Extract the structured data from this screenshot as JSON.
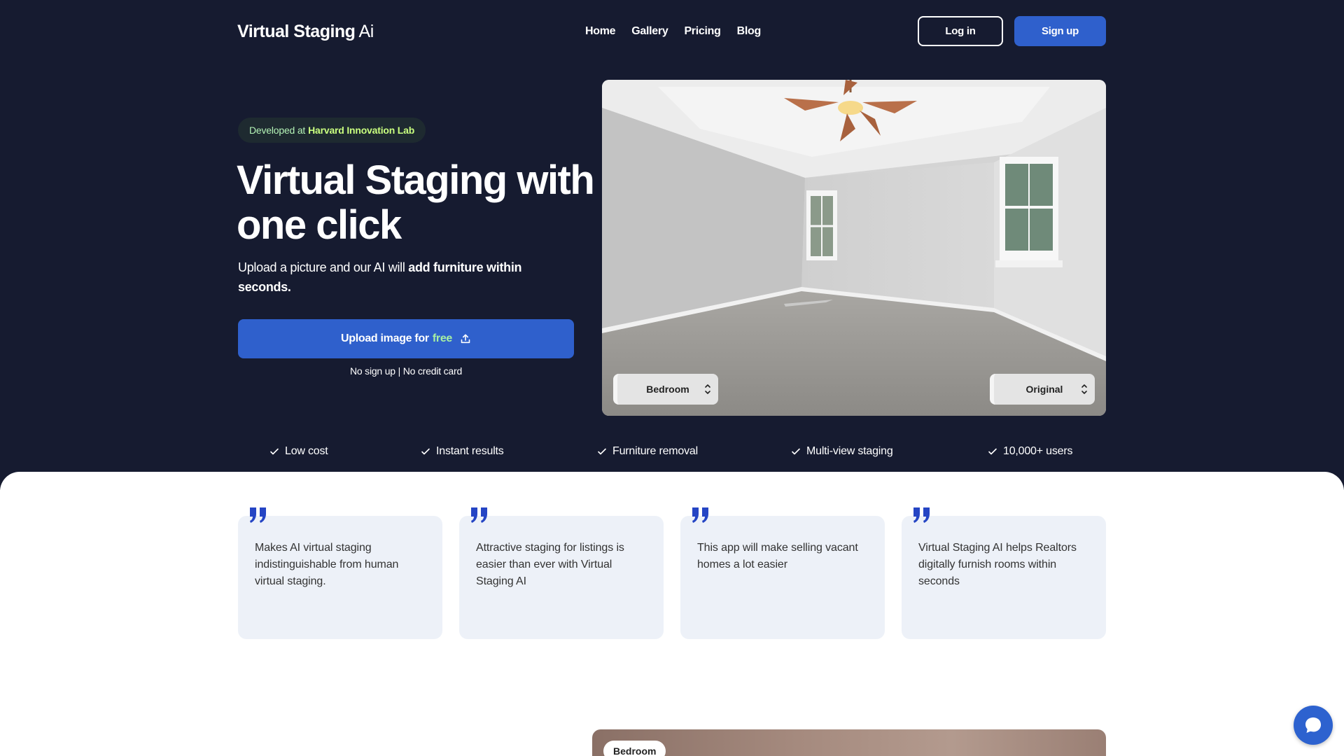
{
  "header": {
    "logo_bold": "Virtual Staging",
    "logo_light": "Ai",
    "nav": [
      {
        "label": "Home"
      },
      {
        "label": "Gallery"
      },
      {
        "label": "Pricing"
      },
      {
        "label": "Blog"
      }
    ],
    "login_label": "Log in",
    "signup_label": "Sign up"
  },
  "hero": {
    "badge_prefix": "Developed at",
    "badge_org": "Harvard Innovation Lab",
    "headline": "Virtual Staging with one click",
    "sub_plain": "Upload a picture and our AI will",
    "sub_bold": "add furniture within seconds.",
    "upload_prefix": "Upload image for",
    "upload_free": "free",
    "upload_icon": "upload-icon",
    "note": "No sign up | No credit card"
  },
  "preview_image": {
    "room_select": "Bedroom",
    "view_select": "Original"
  },
  "features": [
    {
      "label": "Low cost"
    },
    {
      "label": "Instant results"
    },
    {
      "label": "Furniture removal"
    },
    {
      "label": "Multi-view staging"
    },
    {
      "label": "10,000+ users"
    }
  ],
  "testimonials": [
    {
      "text": "Makes AI virtual staging indistinguishable from human virtual staging."
    },
    {
      "text": "Attractive staging for listings is easier than ever with Virtual Staging AI"
    },
    {
      "text": "This app will make selling vacant homes a lot easier"
    },
    {
      "text": "Virtual Staging AI helps Realtors digitally furnish rooms within seconds"
    }
  ],
  "gallery_preview": {
    "room_label": "Bedroom"
  },
  "colors": {
    "hero_bg": "#161b30",
    "accent": "#2f60cc",
    "free_green": "#a7f0a2",
    "card_bg": "#edf1f8",
    "quote_blue": "#2545c4"
  },
  "chat_icon": "chat-bubble-icon"
}
